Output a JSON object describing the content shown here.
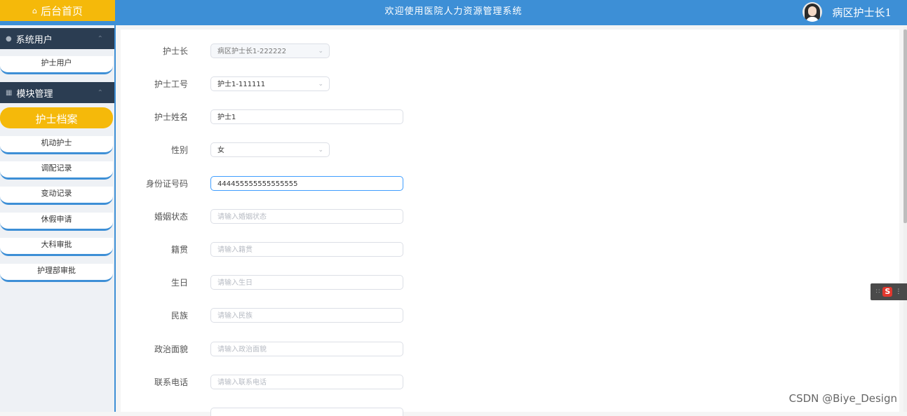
{
  "header": {
    "home_label": "后台首页",
    "home_icon": "home-icon",
    "welcome_title": "欢迎使用医院人力资源管理系统",
    "user_name": "病区护士长1",
    "colors": {
      "topbar": "#3d8fd6",
      "accent": "#f5b90a"
    }
  },
  "sidebar": {
    "sections": [
      {
        "title": "系统用户",
        "icon": "user-icon"
      },
      {
        "title": "模块管理",
        "icon": "grid-icon"
      }
    ],
    "items": [
      {
        "label": "护士用户"
      },
      {
        "label": "护士档案"
      },
      {
        "label": "机动护士"
      },
      {
        "label": "调配记录"
      },
      {
        "label": "变动记录"
      },
      {
        "label": "休假申请"
      },
      {
        "label": "大科审批"
      },
      {
        "label": "护理部审批"
      }
    ],
    "active_item": "护士档案"
  },
  "form": {
    "fields": [
      {
        "label": "护士长",
        "value": "病区护士长1-222222",
        "placeholder": ""
      },
      {
        "label": "护士工号",
        "value": "护士1-111111",
        "placeholder": ""
      },
      {
        "label": "护士姓名",
        "value": "护士1",
        "placeholder": ""
      },
      {
        "label": "性别",
        "value": "女",
        "placeholder": ""
      },
      {
        "label": "身份证号码",
        "value": "444455555555555555",
        "placeholder": ""
      },
      {
        "label": "婚姻状态",
        "value": "",
        "placeholder": "请输入婚姻状态"
      },
      {
        "label": "籍贯",
        "value": "",
        "placeholder": "请输入籍贯"
      },
      {
        "label": "生日",
        "value": "",
        "placeholder": "请输入生日"
      },
      {
        "label": "民族",
        "value": "",
        "placeholder": "请输入民族"
      },
      {
        "label": "政治面貌",
        "value": "",
        "placeholder": "请输入政治面貌"
      },
      {
        "label": "联系电话",
        "value": "",
        "placeholder": "请输入联系电话"
      }
    ]
  },
  "watermark": "CSDN @Biye_Design"
}
